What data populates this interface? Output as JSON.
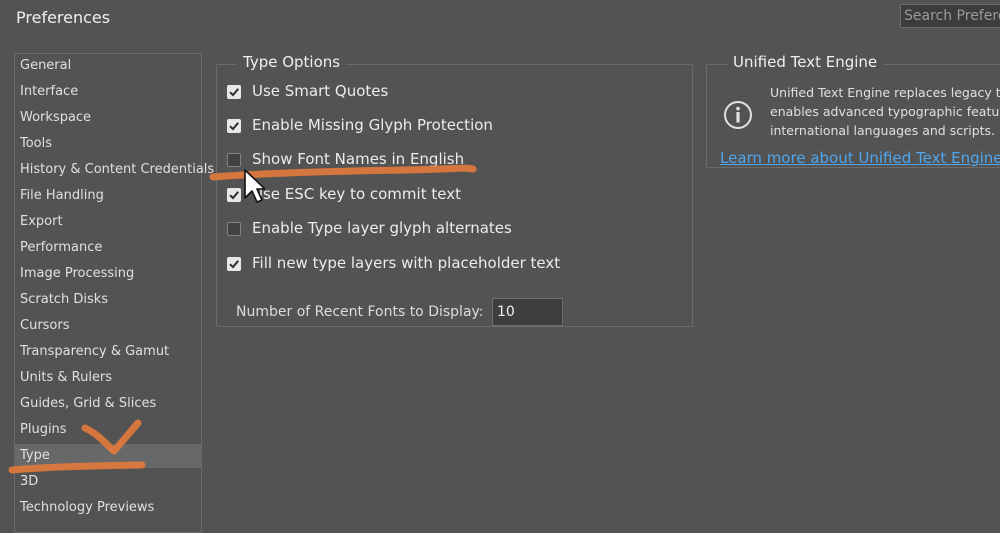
{
  "window": {
    "title": "Preferences"
  },
  "search": {
    "placeholder": "Search Preferences"
  },
  "sidebar": {
    "items": [
      {
        "label": "General"
      },
      {
        "label": "Interface"
      },
      {
        "label": "Workspace"
      },
      {
        "label": "Tools"
      },
      {
        "label": "History & Content Credentials"
      },
      {
        "label": "File Handling"
      },
      {
        "label": "Export"
      },
      {
        "label": "Performance"
      },
      {
        "label": "Image Processing"
      },
      {
        "label": "Scratch Disks"
      },
      {
        "label": "Cursors"
      },
      {
        "label": "Transparency & Gamut"
      },
      {
        "label": "Units & Rulers"
      },
      {
        "label": "Guides, Grid & Slices"
      },
      {
        "label": "Plugins"
      },
      {
        "label": "Type",
        "selected": true
      },
      {
        "label": "3D"
      },
      {
        "label": "Technology Previews"
      }
    ]
  },
  "type_options": {
    "title": "Type Options",
    "options": [
      {
        "label": "Use Smart Quotes",
        "checked": true
      },
      {
        "label": "Enable Missing Glyph Protection",
        "checked": true
      },
      {
        "label": "Show Font Names in English",
        "checked": false
      },
      {
        "label": "Use ESC key to commit text",
        "checked": true
      },
      {
        "label": "Enable Type layer glyph alternates",
        "checked": false
      },
      {
        "label": "Fill new type layers with placeholder text",
        "checked": true
      }
    ],
    "recent_fonts": {
      "label": "Number of Recent Fonts to Display:",
      "value": "10"
    }
  },
  "unified_text_engine": {
    "title": "Unified Text Engine",
    "lines": [
      "Unified Text Engine replaces legacy text",
      "enables advanced typographic features",
      "international languages and scripts."
    ],
    "link": "Learn more about Unified Text Engine",
    "icon": "info-icon"
  },
  "colors": {
    "background": "#535353",
    "link": "#4ea6ee",
    "annotation": "#e07a3c",
    "selected_item": "#686868"
  }
}
